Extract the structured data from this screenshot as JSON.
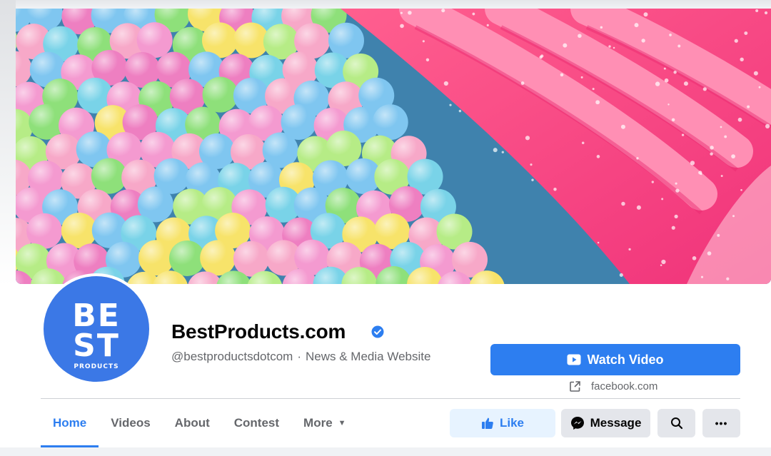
{
  "profile": {
    "name": "BestProducts.com",
    "handle": "@bestproductsdotcom",
    "separator": "·",
    "category": "News & Media Website",
    "verified": true,
    "avatar_lines": [
      "BE",
      "ST",
      "PRODUCTS"
    ],
    "avatar_color": "#3b78e6"
  },
  "cta": {
    "label": "Watch Video",
    "icon": "play-video-icon",
    "color": "#2d7ef0"
  },
  "website": {
    "icon": "external-link-icon",
    "text": "facebook.com"
  },
  "tabs": [
    {
      "label": "Home",
      "active": true
    },
    {
      "label": "Videos",
      "active": false
    },
    {
      "label": "About",
      "active": false
    },
    {
      "label": "Contest",
      "active": false
    },
    {
      "label": "More",
      "active": false,
      "icon": "caret-down-icon"
    }
  ],
  "actions": {
    "like": {
      "label": "Like",
      "icon": "thumbs-up-icon"
    },
    "message": {
      "label": "Message",
      "icon": "messenger-icon"
    },
    "search": {
      "icon": "search-icon"
    },
    "more": {
      "label": "•••",
      "icon": "more-dots-icon"
    }
  },
  "colors": {
    "accent": "#2d7ef0",
    "like_bg": "#e7f3ff",
    "secondary_bg": "#e4e6eb",
    "muted_text": "#65676b"
  }
}
